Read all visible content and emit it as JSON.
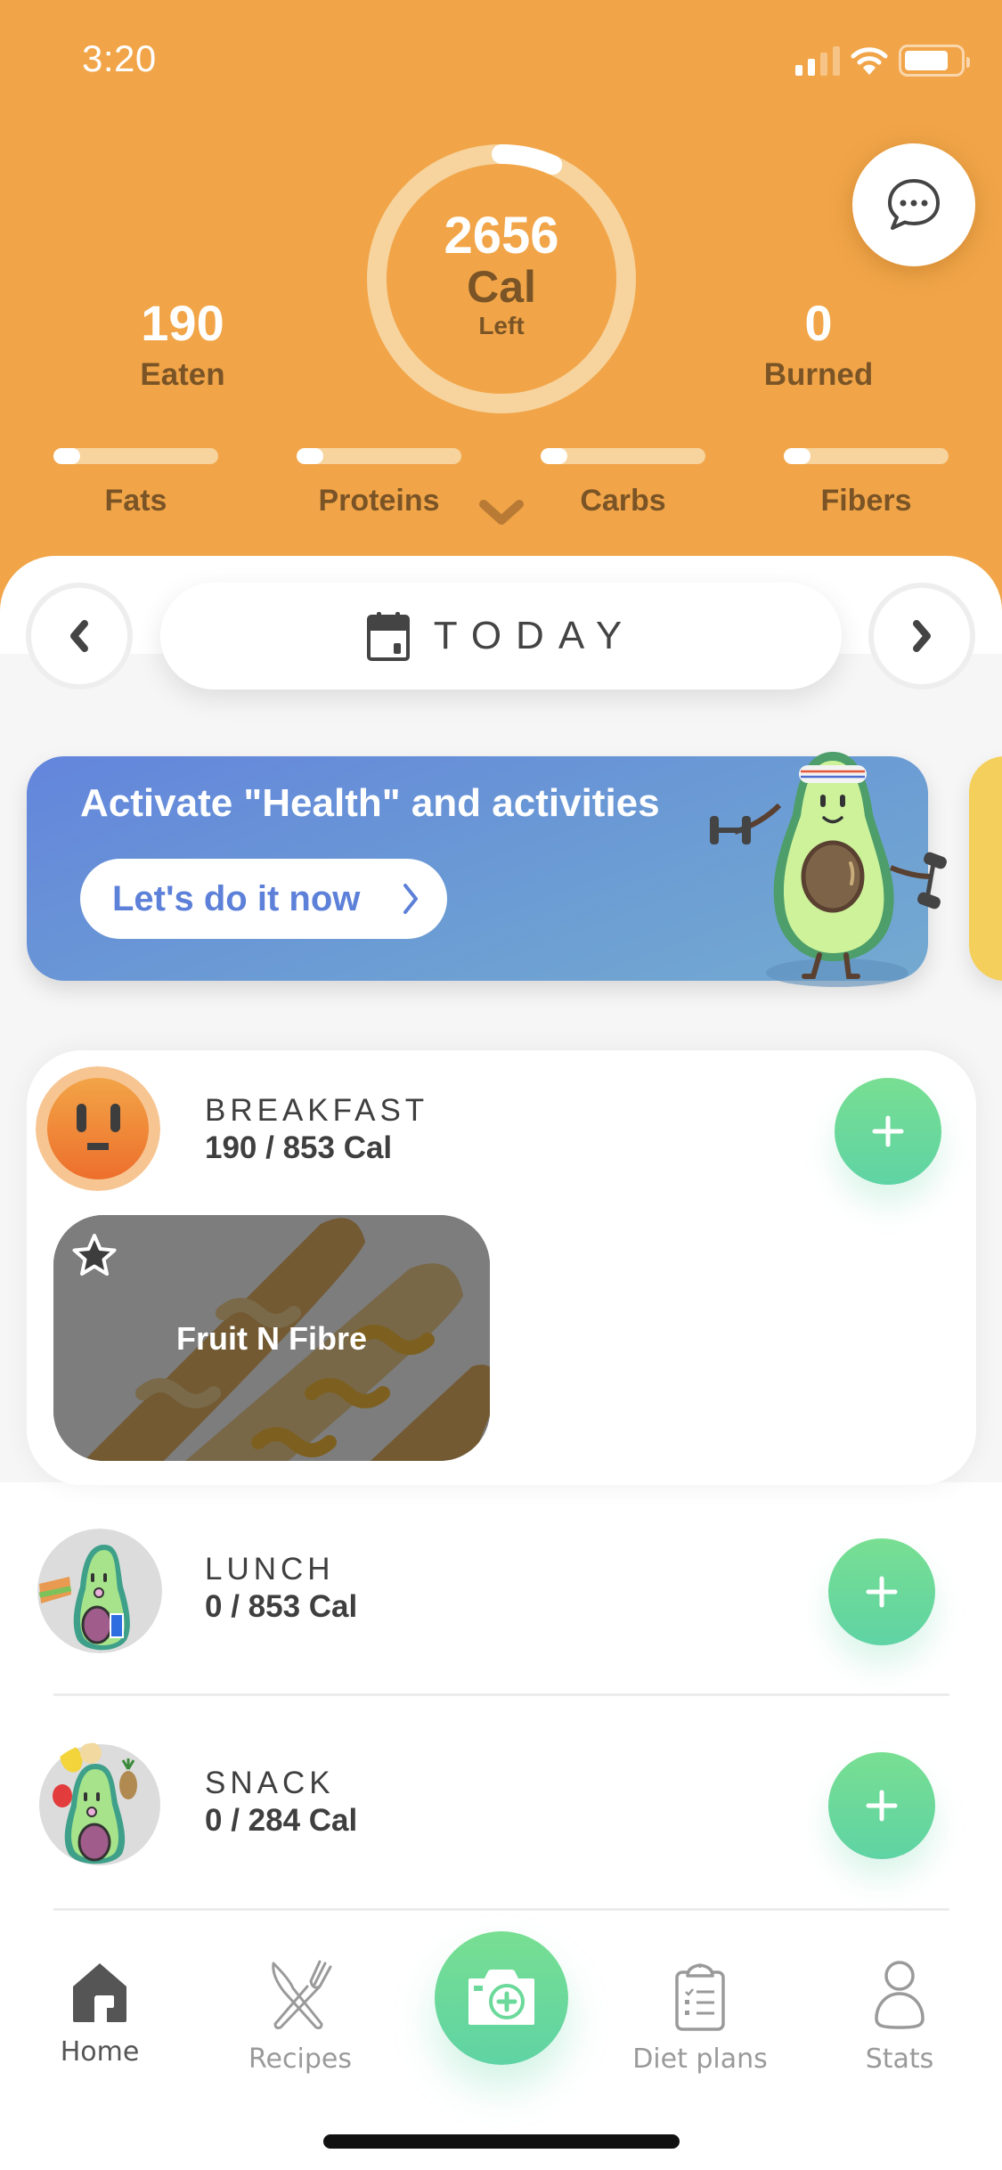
{
  "status_bar": {
    "time": "3:20",
    "signal_bars_active": 2,
    "signal_bars_total": 4,
    "battery_level": 0.8
  },
  "header": {
    "chat_button_icon": "chat-bubble-ellipsis-icon",
    "calories_left": {
      "value": "2656",
      "unit": "Cal",
      "label": "Left",
      "progress": 0.067
    },
    "eaten": {
      "value": "190",
      "label": "Eaten"
    },
    "burned": {
      "value": "0",
      "label": "Burned"
    },
    "macros": [
      {
        "label": "Fats",
        "progress": 0.04
      },
      {
        "label": "Proteins",
        "progress": 0.04
      },
      {
        "label": "Carbs",
        "progress": 0.04
      },
      {
        "label": "Fibers",
        "progress": 0.04
      }
    ],
    "expand_icon": "chevron-down-icon"
  },
  "date_nav": {
    "label": "TODAY",
    "prev_icon": "chevron-left-icon",
    "next_icon": "chevron-right-icon",
    "calendar_icon": "calendar-icon"
  },
  "banner": {
    "title": "Activate \"Health\" and activities",
    "cta_label": "Let's do it now",
    "colors": {
      "start": "#6385dc",
      "end": "#74aad1",
      "next_card": "#f5cf5c"
    }
  },
  "meals": [
    {
      "title": "BREAKFAST",
      "calories": "190 / 853 Cal",
      "items": [
        {
          "name": "Fruit N Fibre",
          "favorite_icon": "star-icon"
        }
      ]
    },
    {
      "title": "LUNCH",
      "calories": "0 / 853 Cal",
      "items": []
    },
    {
      "title": "SNACK",
      "calories": "0 / 284 Cal",
      "items": []
    }
  ],
  "tabbar": {
    "tabs": [
      {
        "label": "Home",
        "icon": "home-icon",
        "active": true
      },
      {
        "label": "Recipes",
        "icon": "fork-knife-icon",
        "active": false
      },
      {
        "label": "Diet plans",
        "icon": "clipboard-icon",
        "active": false
      },
      {
        "label": "Stats",
        "icon": "person-icon",
        "active": false
      }
    ],
    "center_action_icon": "camera-plus-icon"
  },
  "colors": {
    "header": "#f1a548",
    "accent_green": "#6bd99a",
    "label_brown": "#7a5426"
  }
}
